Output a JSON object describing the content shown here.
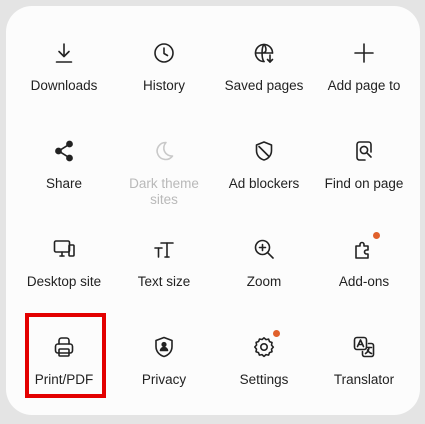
{
  "menu": {
    "items": [
      {
        "name": "downloads",
        "label": "Downloads",
        "icon": "download-icon"
      },
      {
        "name": "history",
        "label": "History",
        "icon": "clock-icon"
      },
      {
        "name": "saved-pages",
        "label": "Saved pages",
        "icon": "globe-download-icon"
      },
      {
        "name": "add-page-to",
        "label": "Add page to",
        "icon": "plus-icon"
      },
      {
        "name": "share",
        "label": "Share",
        "icon": "share-icon"
      },
      {
        "name": "dark-theme-sites",
        "label": "Dark theme\nsites",
        "icon": "moon-icon",
        "disabled": true
      },
      {
        "name": "ad-blockers",
        "label": "Ad blockers",
        "icon": "shield-slash-icon"
      },
      {
        "name": "find-on-page",
        "label": "Find on page",
        "icon": "find-page-icon"
      },
      {
        "name": "desktop-site",
        "label": "Desktop site",
        "icon": "desktop-icon"
      },
      {
        "name": "text-size",
        "label": "Text size",
        "icon": "text-size-icon"
      },
      {
        "name": "zoom",
        "label": "Zoom",
        "icon": "zoom-in-icon"
      },
      {
        "name": "add-ons",
        "label": "Add-ons",
        "icon": "puzzle-icon",
        "badge": true
      },
      {
        "name": "print-pdf",
        "label": "Print/PDF",
        "icon": "printer-icon",
        "highlighted": true
      },
      {
        "name": "privacy",
        "label": "Privacy",
        "icon": "privacy-shield-icon"
      },
      {
        "name": "settings",
        "label": "Settings",
        "icon": "gear-icon",
        "badge": true
      },
      {
        "name": "translator",
        "label": "Translator",
        "icon": "translate-icon"
      }
    ]
  },
  "colors": {
    "highlight": "#e30000",
    "badge": "#e0602b",
    "disabled_text": "#b9b9b9"
  }
}
